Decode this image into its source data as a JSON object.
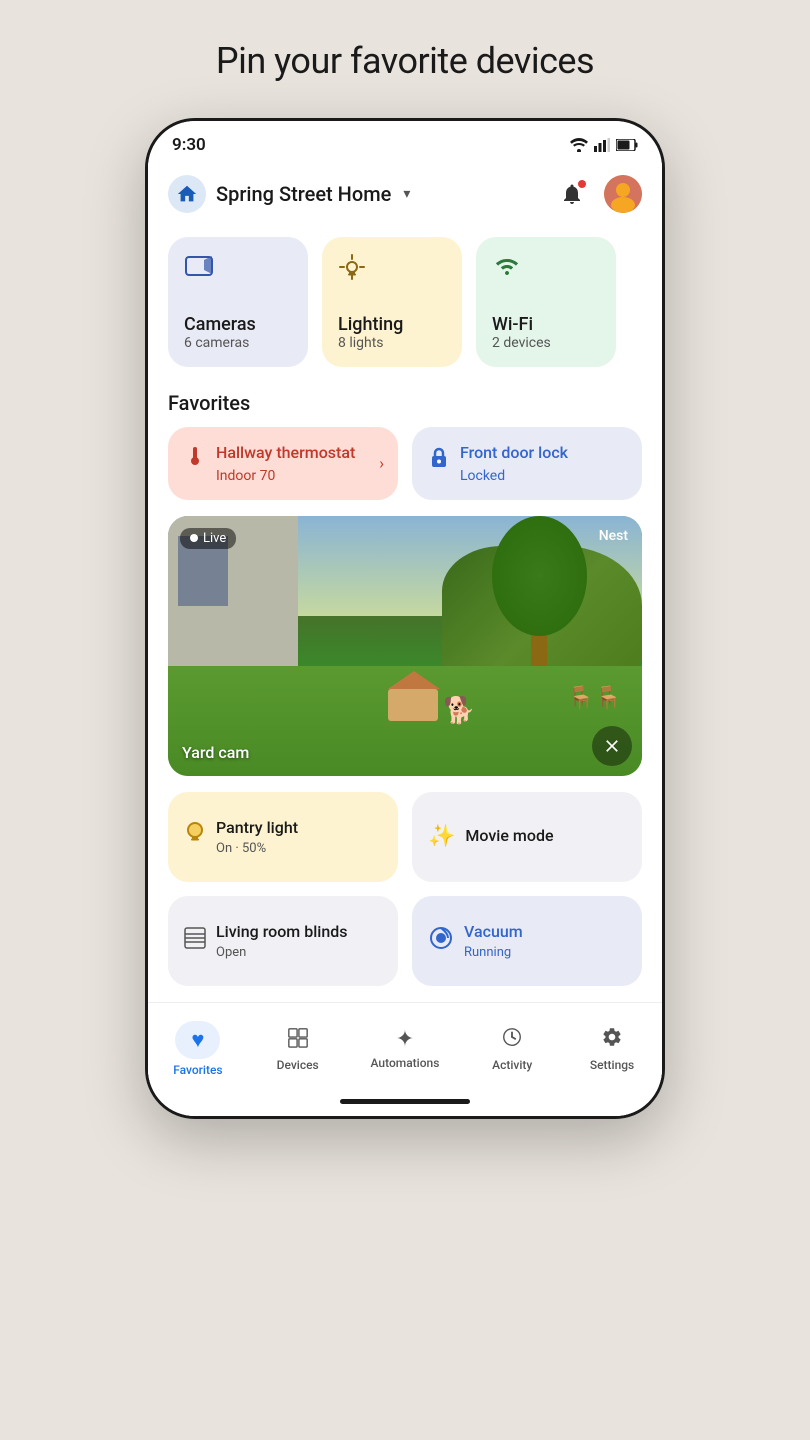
{
  "page": {
    "title": "Pin your favorite devices"
  },
  "status_bar": {
    "time": "9:30"
  },
  "header": {
    "home_name": "Spring Street Home",
    "dropdown_label": "Spring Street Home dropdown"
  },
  "categories": [
    {
      "id": "cameras",
      "name": "Cameras",
      "count": "6 cameras",
      "icon": "📷",
      "color": "cat-cameras"
    },
    {
      "id": "lighting",
      "name": "Lighting",
      "count": "8 lights",
      "icon": "💡",
      "color": "cat-lighting"
    },
    {
      "id": "wifi",
      "name": "Wi-Fi",
      "count": "2 devices",
      "icon": "📶",
      "color": "cat-wifi"
    }
  ],
  "favorites_section": {
    "label": "Favorites"
  },
  "favorite_cards": [
    {
      "id": "thermostat",
      "title": "Hallway thermostat",
      "subtitle": "Indoor 70",
      "icon": "🌡️",
      "type": "thermostat",
      "has_chevron": true
    },
    {
      "id": "door-lock",
      "title": "Front door lock",
      "subtitle": "Locked",
      "icon": "🔒",
      "type": "lock",
      "has_chevron": false
    }
  ],
  "camera_feed": {
    "label": "Live",
    "brand": "Nest",
    "name": "Yard cam"
  },
  "bottom_cards": [
    {
      "id": "pantry-light",
      "title": "Pantry light",
      "subtitle": "On · 50%",
      "icon": "💡",
      "type": "pantry"
    },
    {
      "id": "movie-mode",
      "title": "Movie mode",
      "subtitle": "",
      "icon": "✨",
      "type": "movie"
    },
    {
      "id": "living-room-blinds",
      "title": "Living room blinds",
      "subtitle": "Open",
      "icon": "⊞",
      "type": "blinds"
    },
    {
      "id": "vacuum",
      "title": "Vacuum",
      "subtitle": "Running",
      "icon": "🤖",
      "type": "vacuum"
    }
  ],
  "nav": {
    "items": [
      {
        "id": "favorites",
        "label": "Favorites",
        "icon": "♥",
        "active": true
      },
      {
        "id": "devices",
        "label": "Devices",
        "icon": "⊞",
        "active": false
      },
      {
        "id": "automations",
        "label": "Automations",
        "icon": "✦",
        "active": false
      },
      {
        "id": "activity",
        "label": "Activity",
        "icon": "⏱",
        "active": false
      },
      {
        "id": "settings",
        "label": "Settings",
        "icon": "⚙",
        "active": false
      }
    ]
  }
}
